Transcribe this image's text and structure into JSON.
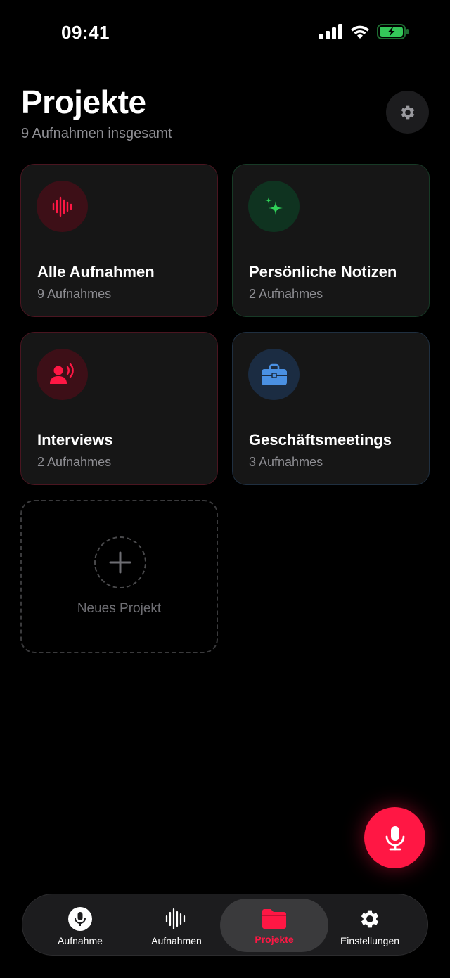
{
  "status": {
    "time": "09:41"
  },
  "header": {
    "title": "Projekte",
    "subtitle": "9 Aufnahmen insgesamt"
  },
  "projects": [
    {
      "title": "Alle Aufnahmen",
      "count": "9 Aufnahmes",
      "accent": "#ff1744",
      "icon": "waveform-icon"
    },
    {
      "title": "Persönliche Notizen",
      "count": "2 Aufnahmes",
      "accent": "#30d158",
      "icon": "sparkles-icon"
    },
    {
      "title": "Interviews",
      "count": "2 Aufnahmes",
      "accent": "#ff1744",
      "icon": "person-voice-icon"
    },
    {
      "title": "Geschäftsmeetings",
      "count": "3 Aufnahmes",
      "accent": "#4a90e2",
      "icon": "briefcase-icon"
    }
  ],
  "new_project": {
    "label": "Neues Projekt"
  },
  "tabs": [
    {
      "label": "Aufnahme",
      "icon": "mic-icon"
    },
    {
      "label": "Aufnahmen",
      "icon": "waveform-icon"
    },
    {
      "label": "Projekte",
      "icon": "folder-icon",
      "active": true
    },
    {
      "label": "Einstellungen",
      "icon": "gear-icon"
    }
  ]
}
